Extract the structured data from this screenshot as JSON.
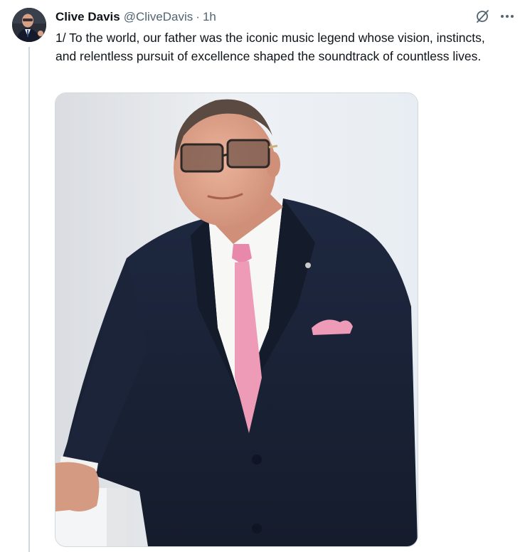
{
  "author": {
    "display_name": "Clive Davis",
    "handle": "@CliveDavis",
    "separator": "·",
    "timestamp": "1h",
    "avatar_icon": "profile-photo"
  },
  "actions": {
    "grok_icon": "grok-icon",
    "more_icon": "more-horizontal-icon"
  },
  "tweet": {
    "text": "1/ To the world, our father was the iconic music legend whose vision, instincts, and relentless pursuit of excellence shaped the soundtrack of countless lives."
  },
  "media": {
    "type": "photo",
    "description_icon": "photo-of-man-in-navy-suit-pink-tie",
    "colors": {
      "background": "#e9edf2",
      "suit": "#1c2537",
      "tie": "#ee9bb8",
      "shirt": "#f7f7f6",
      "skin": "#e2a58d"
    }
  },
  "colors": {
    "text_primary": "#0f1419",
    "text_secondary": "#536471",
    "border": "#cfd9de"
  }
}
